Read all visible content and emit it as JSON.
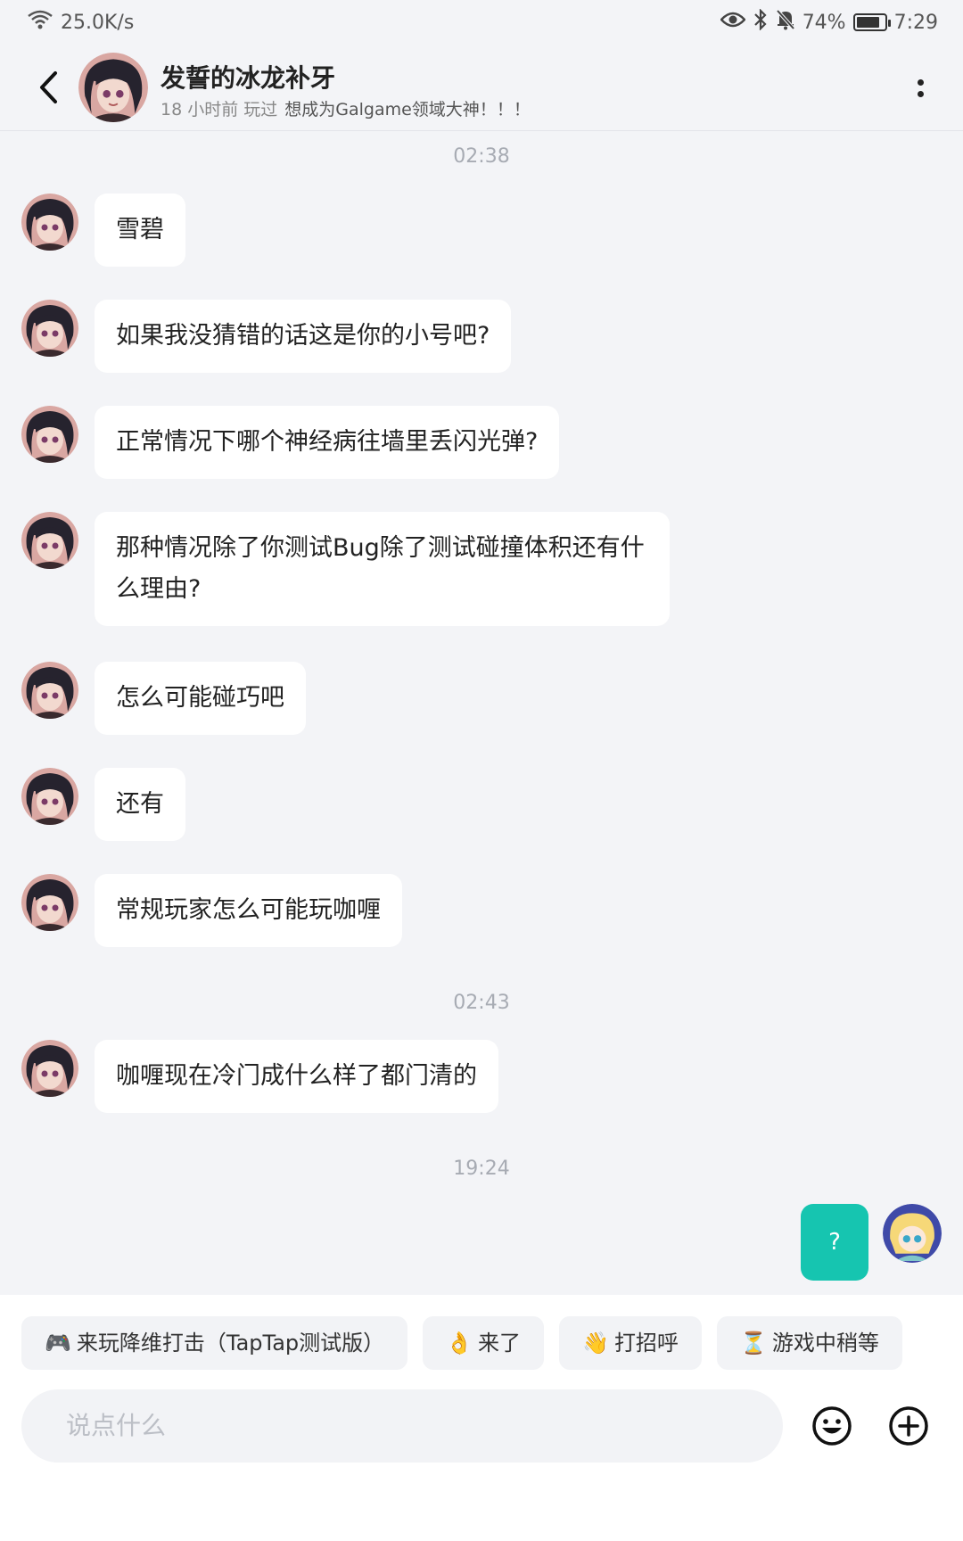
{
  "status_bar": {
    "net_speed": "25.0K/s",
    "battery": "74%",
    "time": "7:29"
  },
  "header": {
    "name": "发誓的冰龙补牙",
    "sub_time": "18 小时前 玩过",
    "signature": "想成为Galgame领域大神！！！"
  },
  "messages": [
    {
      "timestamp": "02:38"
    },
    {
      "text": "雪碧"
    },
    {
      "text": "如果我没猜错的话这是你的小号吧?"
    },
    {
      "text": "正常情况下哪个神经病往墙里丢闪光弹?"
    },
    {
      "text": "那种情况除了你测试Bug除了测试碰撞体积还有什么理由?"
    },
    {
      "text": "怎么可能碰巧吧"
    },
    {
      "text": "还有"
    },
    {
      "text": "常规玩家怎么可能玩咖喱"
    },
    {
      "timestamp": "02:43"
    },
    {
      "text": "咖喱现在冷门成什么样了都门清的"
    },
    {
      "timestamp": "19:24"
    }
  ],
  "my_message": {
    "text": "?"
  },
  "quick_replies": [
    {
      "icon": "🎮",
      "label": "来玩降维打击（TapTap测试版）"
    },
    {
      "icon": "👌",
      "label": "来了"
    },
    {
      "icon": "👋",
      "label": "打招呼"
    },
    {
      "icon": "⏳",
      "label": "游戏中稍等"
    }
  ],
  "input": {
    "placeholder": "说点什么"
  }
}
